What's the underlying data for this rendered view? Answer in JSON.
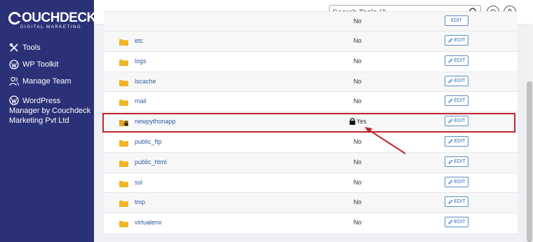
{
  "brand": {
    "name": "OUCHDECK",
    "tagline": "DIGITAL MARKETING"
  },
  "sidebar": {
    "items": [
      {
        "label": "Tools",
        "icon": "tools-icon"
      },
      {
        "label": "WP Toolkit",
        "icon": "wordpress-icon"
      },
      {
        "label": "Manage Team",
        "icon": "team-icon"
      },
      {
        "label": "WordPress Manager by Couchdeck Marketing Pvt Ltd",
        "icon": "wordpress-icon"
      }
    ]
  },
  "header": {
    "search_placeholder": "Search Tools (/)"
  },
  "table": {
    "edit_label": "EDIT",
    "rows": [
      {
        "name": "etc",
        "permission": "No",
        "locked": false
      },
      {
        "name": "logs",
        "permission": "No",
        "locked": false
      },
      {
        "name": "lscache",
        "permission": "No",
        "locked": false
      },
      {
        "name": "mail",
        "permission": "No",
        "locked": false
      },
      {
        "name": "newpythonapp",
        "permission": "Yes",
        "locked": true
      },
      {
        "name": "public_ftp",
        "permission": "No",
        "locked": false
      },
      {
        "name": "public_html",
        "permission": "No",
        "locked": false
      },
      {
        "name": "ssl",
        "permission": "No",
        "locked": false
      },
      {
        "name": "tmp",
        "permission": "No",
        "locked": false
      },
      {
        "name": "virtualenv",
        "permission": "No",
        "locked": false
      }
    ]
  },
  "colors": {
    "sidebar_bg": "#2b3177",
    "highlight": "#c0272d",
    "folder": "#f0b429",
    "link": "#2b5e9e"
  }
}
